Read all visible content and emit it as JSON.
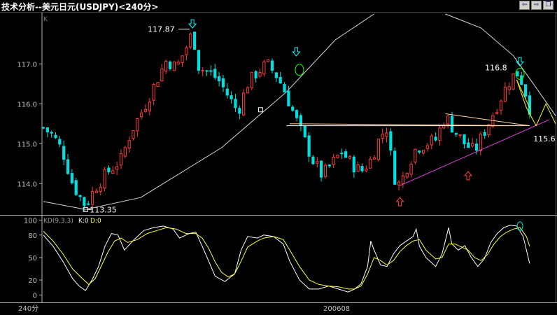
{
  "window": {
    "title": "技术分析--美元日元(USDJPY)<240分>",
    "buttons": [
      {
        "name": "prev-button",
        "glyph": "⇦"
      },
      {
        "name": "next-button",
        "glyph": "⇨"
      },
      {
        "name": "restore-button",
        "glyph": "❐"
      }
    ]
  },
  "chart_data": [
    {
      "type": "candlestick",
      "panel_label": "K",
      "y_ticks": [
        114.0,
        115.0,
        116.0,
        117.0
      ],
      "y_tick_labels": [
        "114.0",
        "115.0",
        "116.0",
        "117.0"
      ],
      "ylim": [
        113.25,
        118.25
      ],
      "x_period_label": "240分",
      "x_date_label": "200608",
      "colors": {
        "up": "#ff3a3a",
        "down": "#00e0e0",
        "trend_down_1": "#ffffff",
        "trend_down_2": "#ffd0a0",
        "support": "#e040e0",
        "projection": "#ffff00",
        "arc": "#d8d8d8",
        "up_arrow": "#ff4040",
        "down_arrow": "#00ffff",
        "circle_mark": "#00ff00"
      },
      "candle_count": 120,
      "close_path": [
        [
          0,
          115.4
        ],
        [
          3,
          115.2
        ],
        [
          6,
          114.8
        ],
        [
          9,
          114.0
        ],
        [
          11,
          113.7
        ],
        [
          13,
          113.45
        ],
        [
          16,
          113.9
        ],
        [
          20,
          114.3
        ],
        [
          24,
          114.6
        ],
        [
          27,
          115.3
        ],
        [
          31,
          115.9
        ],
        [
          35,
          116.6
        ],
        [
          38,
          117.1
        ],
        [
          41,
          116.9
        ],
        [
          44,
          117.4
        ],
        [
          46,
          117.8
        ],
        [
          48,
          116.9
        ],
        [
          51,
          116.8
        ],
        [
          54,
          116.6
        ],
        [
          57,
          116.2
        ],
        [
          60,
          115.8
        ],
        [
          63,
          116.5
        ],
        [
          66,
          116.8
        ],
        [
          69,
          117.0
        ],
        [
          72,
          116.7
        ],
        [
          74,
          116.4
        ],
        [
          76,
          116.0
        ],
        [
          78,
          115.6
        ],
        [
          80,
          115.2
        ],
        [
          83,
          114.6
        ],
        [
          86,
          114.2
        ],
        [
          89,
          114.5
        ],
        [
          92,
          114.8
        ],
        [
          95,
          114.5
        ],
        [
          98,
          114.3
        ],
        [
          101,
          114.6
        ],
        [
          104,
          115.2
        ],
        [
          106,
          115.4
        ],
        [
          108,
          114.2
        ],
        [
          110,
          113.95
        ],
        [
          112,
          114.4
        ],
        [
          115,
          114.9
        ],
        [
          118,
          115.0
        ],
        [
          121,
          115.1
        ],
        [
          124,
          115.7
        ],
        [
          127,
          115.3
        ],
        [
          130,
          115.0
        ],
        [
          133,
          114.8
        ],
        [
          136,
          115.3
        ],
        [
          139,
          115.8
        ],
        [
          142,
          116.3
        ],
        [
          144,
          116.6
        ],
        [
          146,
          116.8
        ],
        [
          148,
          116.5
        ],
        [
          149,
          116.2
        ],
        [
          150,
          115.9
        ]
      ],
      "annotations": [
        {
          "text": "117.87",
          "x": 46,
          "y": 117.87,
          "arrow": "down"
        },
        {
          "text": "113.35",
          "x": 13,
          "y": 113.35
        },
        {
          "text": "116.8",
          "x": 144,
          "y": 116.8,
          "arrow": "down"
        },
        {
          "text": "115.6",
          "x": 152,
          "y": 115.3
        }
      ],
      "arrows_down": [
        [
          46,
          117.95
        ],
        [
          78,
          117.25
        ],
        [
          147,
          117.0
        ]
      ],
      "arrows_up": [
        [
          110,
          113.6
        ],
        [
          131,
          114.25
        ]
      ],
      "square_marks": [
        [
          13,
          113.35
        ],
        [
          67,
          115.85
        ]
      ],
      "circle_marks": [
        [
          79,
          116.85
        ],
        [
          147,
          116.75
        ]
      ],
      "lines": [
        {
          "name": "resistance-line-white",
          "from": [
            75,
            115.45
          ],
          "to": [
            148,
            115.45
          ],
          "color": "trend_down_1"
        },
        {
          "name": "resistance-line-peach",
          "from": [
            76,
            115.5
          ],
          "to": [
            150,
            115.45
          ],
          "color": "trend_down_2"
        },
        {
          "name": "falling-line-peach",
          "from": [
            124,
            115.75
          ],
          "to": [
            150,
            115.45
          ],
          "color": "trend_down_2"
        },
        {
          "name": "support-line-magenta",
          "from": [
            110,
            113.95
          ],
          "to": [
            156,
            115.6
          ],
          "color": "support"
        },
        {
          "name": "projection-line-yellow",
          "from": [
            146,
            116.6
          ],
          "to": [
            150,
            115.9
          ],
          "color": "projection"
        }
      ],
      "projection_path": [
        [
          146,
          116.6
        ],
        [
          149,
          115.9
        ],
        [
          152,
          115.45
        ],
        [
          155,
          116.0
        ],
        [
          158,
          115.5
        ]
      ],
      "arc_left": [
        [
          0,
          113.55
        ],
        [
          13,
          113.35
        ],
        [
          30,
          113.65
        ],
        [
          55,
          114.9
        ],
        [
          75,
          116.3
        ],
        [
          90,
          117.6
        ],
        [
          102,
          118.25
        ]
      ],
      "arc_right": [
        [
          124,
          118.25
        ],
        [
          135,
          117.9
        ],
        [
          145,
          117.2
        ],
        [
          152,
          116.4
        ],
        [
          158,
          115.7
        ]
      ]
    },
    {
      "type": "line",
      "panel_label": "KD(9,3,3) K:0 D:0",
      "indicator_label": "KD(9,3,3)",
      "k_label": "K:0",
      "d_label": "D:0",
      "y_ticks": [
        0,
        20,
        50,
        80,
        100
      ],
      "y_tick_labels": [
        "0",
        "20",
        "50",
        "80",
        "100"
      ],
      "ylim": [
        -8,
        105
      ],
      "series": [
        {
          "name": "K",
          "color": "#ffffff",
          "points": [
            [
              0,
              80
            ],
            [
              3,
              65
            ],
            [
              6,
              45
            ],
            [
              9,
              22
            ],
            [
              11,
              12
            ],
            [
              13,
              6
            ],
            [
              15,
              20
            ],
            [
              17,
              38
            ],
            [
              19,
              65
            ],
            [
              21,
              82
            ],
            [
              23,
              80
            ],
            [
              25,
              60
            ],
            [
              28,
              74
            ],
            [
              31,
              86
            ],
            [
              34,
              90
            ],
            [
              37,
              92
            ],
            [
              40,
              88
            ],
            [
              42,
              76
            ],
            [
              45,
              82
            ],
            [
              47,
              84
            ],
            [
              49,
              65
            ],
            [
              51,
              45
            ],
            [
              53,
              25
            ],
            [
              56,
              18
            ],
            [
              59,
              28
            ],
            [
              61,
              60
            ],
            [
              63,
              78
            ],
            [
              66,
              76
            ],
            [
              68,
              80
            ],
            [
              71,
              78
            ],
            [
              74,
              68
            ],
            [
              76,
              45
            ],
            [
              79,
              20
            ],
            [
              82,
              8
            ],
            [
              85,
              8
            ],
            [
              88,
              12
            ],
            [
              91,
              8
            ],
            [
              94,
              4
            ],
            [
              96,
              8
            ],
            [
              98,
              15
            ],
            [
              100,
              38
            ],
            [
              101,
              72
            ],
            [
              102,
              60
            ],
            [
              104,
              40
            ],
            [
              106,
              38
            ],
            [
              108,
              55
            ],
            [
              110,
              66
            ],
            [
              112,
              72
            ],
            [
              114,
              78
            ],
            [
              115,
              88
            ],
            [
              116,
              65
            ],
            [
              118,
              50
            ],
            [
              121,
              38
            ],
            [
              123,
              55
            ],
            [
              125,
              90
            ],
            [
              126,
              68
            ],
            [
              128,
              60
            ],
            [
              130,
              66
            ],
            [
              132,
              50
            ],
            [
              134,
              38
            ],
            [
              136,
              48
            ],
            [
              138,
              70
            ],
            [
              140,
              82
            ],
            [
              142,
              90
            ],
            [
              144,
              93
            ],
            [
              146,
              92
            ],
            [
              148,
              78
            ],
            [
              150,
              42
            ]
          ]
        },
        {
          "name": "D",
          "color": "#ffff40",
          "points": [
            [
              0,
              85
            ],
            [
              3,
              72
            ],
            [
              6,
              55
            ],
            [
              9,
              35
            ],
            [
              12,
              22
            ],
            [
              14,
              14
            ],
            [
              16,
              22
            ],
            [
              18,
              40
            ],
            [
              20,
              58
            ],
            [
              22,
              72
            ],
            [
              24,
              76
            ],
            [
              26,
              70
            ],
            [
              29,
              74
            ],
            [
              32,
              82
            ],
            [
              35,
              86
            ],
            [
              38,
              90
            ],
            [
              41,
              88
            ],
            [
              44,
              82
            ],
            [
              47,
              82
            ],
            [
              49,
              76
            ],
            [
              51,
              62
            ],
            [
              53,
              44
            ],
            [
              55,
              30
            ],
            [
              57,
              24
            ],
            [
              59,
              28
            ],
            [
              61,
              45
            ],
            [
              63,
              64
            ],
            [
              66,
              72
            ],
            [
              68,
              76
            ],
            [
              71,
              78
            ],
            [
              74,
              74
            ],
            [
              76,
              60
            ],
            [
              79,
              38
            ],
            [
              82,
              20
            ],
            [
              85,
              14
            ],
            [
              88,
              12
            ],
            [
              91,
              11
            ],
            [
              94,
              8
            ],
            [
              96,
              8
            ],
            [
              98,
              12
            ],
            [
              100,
              28
            ],
            [
              102,
              50
            ],
            [
              104,
              46
            ],
            [
              106,
              40
            ],
            [
              108,
              46
            ],
            [
              110,
              58
            ],
            [
              112,
              66
            ],
            [
              114,
              72
            ],
            [
              116,
              74
            ],
            [
              118,
              60
            ],
            [
              121,
              48
            ],
            [
              123,
              50
            ],
            [
              125,
              68
            ],
            [
              127,
              68
            ],
            [
              129,
              64
            ],
            [
              131,
              60
            ],
            [
              133,
              50
            ],
            [
              135,
              46
            ],
            [
              137,
              54
            ],
            [
              139,
              68
            ],
            [
              141,
              78
            ],
            [
              143,
              84
            ],
            [
              145,
              88
            ],
            [
              147,
              90
            ],
            [
              149,
              78
            ],
            [
              150,
              65
            ]
          ]
        }
      ],
      "circle_mark": [
        147,
        92
      ]
    }
  ]
}
